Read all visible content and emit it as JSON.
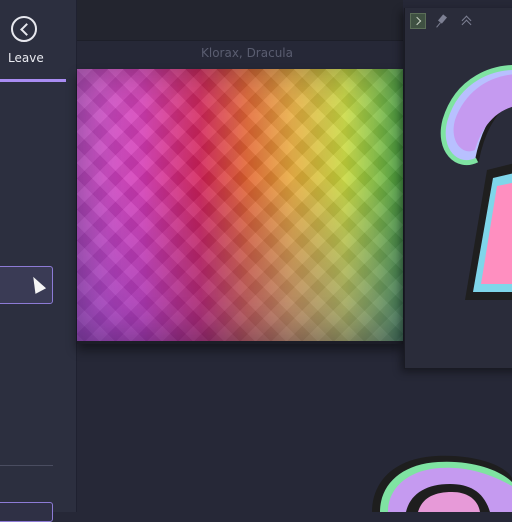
{
  "sidebar": {
    "back_icon": "chevron-left-circle-icon",
    "leave_label": "Leave",
    "accent": "#a98cf2"
  },
  "document": {
    "title": "Klorax, Dracula"
  },
  "panel": {
    "expand_icon": "chevron-right-icon",
    "pin_icon": "pin-icon",
    "collapse_icon": "double-chevron-up-icon"
  },
  "colors": {
    "background": "#262837",
    "sidebar": "#2c2f3f",
    "selection_border": "#8d7bd6"
  }
}
